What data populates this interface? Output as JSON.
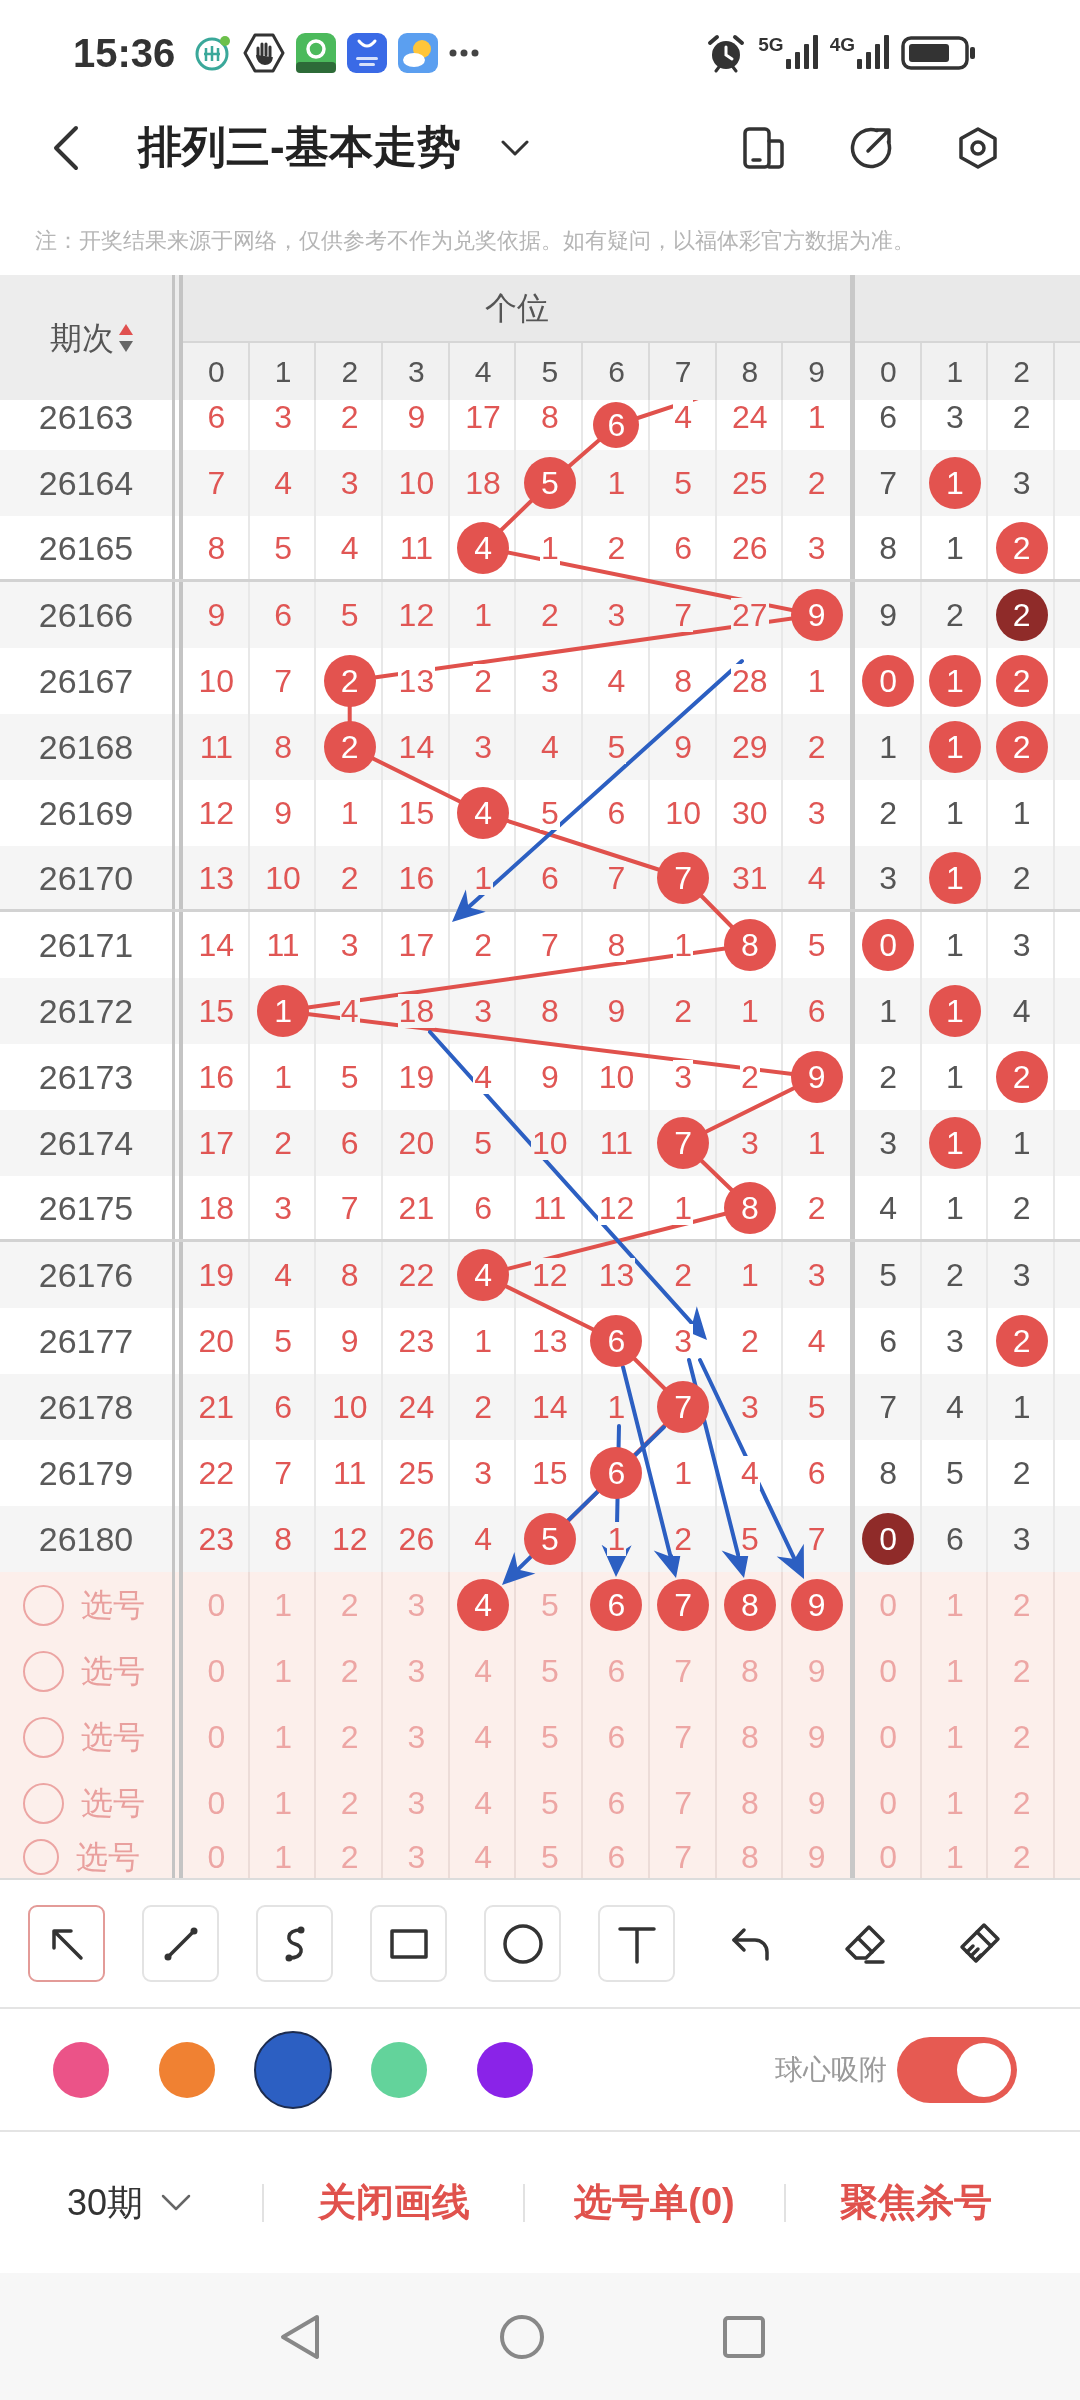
{
  "status_bar": {
    "time": "15:36",
    "networks": [
      "5G",
      "4G"
    ]
  },
  "header": {
    "title": "排列三-基本走势"
  },
  "notice": "注：开奖结果来源于网络，仅供参考不作为兑奖依据。如有疑问，以福体彩官方数据为准。",
  "table": {
    "period_header": "期次",
    "groups": [
      {
        "title": "个位",
        "kind": "accent",
        "columns": [
          "0",
          "1",
          "2",
          "3",
          "4",
          "5",
          "6",
          "7",
          "8",
          "9"
        ]
      },
      {
        "kind": "muted",
        "columns": [
          "0",
          "1",
          "2"
        ]
      }
    ],
    "rows": [
      {
        "period": "26163",
        "cells": [
          [
            {
              "text": "6",
              "kind": "plain"
            },
            {
              "text": "3",
              "kind": "plain"
            },
            {
              "text": "2",
              "kind": "plain"
            },
            {
              "text": "9",
              "kind": "plain"
            },
            {
              "text": "17",
              "kind": "plain"
            },
            {
              "text": "8",
              "kind": "plain"
            },
            {
              "text": "6",
              "kind": "ball"
            },
            {
              "text": "4",
              "kind": "plain"
            },
            {
              "text": "24",
              "kind": "plain"
            },
            {
              "text": "1",
              "kind": "plain"
            }
          ],
          [
            {
              "text": "6",
              "kind": "plain"
            },
            {
              "text": "3",
              "kind": "plain"
            },
            {
              "text": "2",
              "kind": "plain"
            }
          ]
        ]
      },
      {
        "period": "26164",
        "cells": [
          [
            {
              "text": "7",
              "kind": "plain"
            },
            {
              "text": "4",
              "kind": "plain"
            },
            {
              "text": "3",
              "kind": "plain"
            },
            {
              "text": "10",
              "kind": "plain"
            },
            {
              "text": "18",
              "kind": "plain"
            },
            {
              "text": "5",
              "kind": "ball"
            },
            {
              "text": "1",
              "kind": "plain"
            },
            {
              "text": "5",
              "kind": "plain"
            },
            {
              "text": "25",
              "kind": "plain"
            },
            {
              "text": "2",
              "kind": "plain"
            }
          ],
          [
            {
              "text": "7",
              "kind": "plain"
            },
            {
              "text": "1",
              "kind": "ball"
            },
            {
              "text": "3",
              "kind": "plain"
            }
          ]
        ]
      },
      {
        "period": "26165",
        "cells": [
          [
            {
              "text": "8",
              "kind": "plain"
            },
            {
              "text": "5",
              "kind": "plain"
            },
            {
              "text": "4",
              "kind": "plain"
            },
            {
              "text": "11",
              "kind": "plain"
            },
            {
              "text": "4",
              "kind": "ball"
            },
            {
              "text": "1",
              "kind": "plain"
            },
            {
              "text": "2",
              "kind": "plain"
            },
            {
              "text": "6",
              "kind": "plain"
            },
            {
              "text": "26",
              "kind": "plain"
            },
            {
              "text": "3",
              "kind": "plain"
            }
          ],
          [
            {
              "text": "8",
              "kind": "plain"
            },
            {
              "text": "1",
              "kind": "plain"
            },
            {
              "text": "2",
              "kind": "ball"
            }
          ]
        ]
      },
      {
        "period": "26166",
        "cells": [
          [
            {
              "text": "9",
              "kind": "plain"
            },
            {
              "text": "6",
              "kind": "plain"
            },
            {
              "text": "5",
              "kind": "plain"
            },
            {
              "text": "12",
              "kind": "plain"
            },
            {
              "text": "1",
              "kind": "plain"
            },
            {
              "text": "2",
              "kind": "plain"
            },
            {
              "text": "3",
              "kind": "plain"
            },
            {
              "text": "7",
              "kind": "plain"
            },
            {
              "text": "27",
              "kind": "plain"
            },
            {
              "text": "9",
              "kind": "ball"
            }
          ],
          [
            {
              "text": "9",
              "kind": "plain"
            },
            {
              "text": "2",
              "kind": "plain"
            },
            {
              "text": "2",
              "kind": "darkball"
            }
          ]
        ]
      },
      {
        "period": "26167",
        "cells": [
          [
            {
              "text": "10",
              "kind": "plain"
            },
            {
              "text": "7",
              "kind": "plain"
            },
            {
              "text": "2",
              "kind": "ball"
            },
            {
              "text": "13",
              "kind": "plain"
            },
            {
              "text": "2",
              "kind": "plain"
            },
            {
              "text": "3",
              "kind": "plain"
            },
            {
              "text": "4",
              "kind": "plain"
            },
            {
              "text": "8",
              "kind": "plain"
            },
            {
              "text": "28",
              "kind": "plain"
            },
            {
              "text": "1",
              "kind": "plain"
            }
          ],
          [
            {
              "text": "0",
              "kind": "ball"
            },
            {
              "text": "1",
              "kind": "ball"
            },
            {
              "text": "2",
              "kind": "ball"
            }
          ]
        ]
      },
      {
        "period": "26168",
        "cells": [
          [
            {
              "text": "11",
              "kind": "plain"
            },
            {
              "text": "8",
              "kind": "plain"
            },
            {
              "text": "2",
              "kind": "ball"
            },
            {
              "text": "14",
              "kind": "plain"
            },
            {
              "text": "3",
              "kind": "plain"
            },
            {
              "text": "4",
              "kind": "plain"
            },
            {
              "text": "5",
              "kind": "plain"
            },
            {
              "text": "9",
              "kind": "plain"
            },
            {
              "text": "29",
              "kind": "plain"
            },
            {
              "text": "2",
              "kind": "plain"
            }
          ],
          [
            {
              "text": "1",
              "kind": "plain"
            },
            {
              "text": "1",
              "kind": "ball"
            },
            {
              "text": "2",
              "kind": "ball"
            }
          ]
        ]
      },
      {
        "period": "26169",
        "cells": [
          [
            {
              "text": "12",
              "kind": "plain"
            },
            {
              "text": "9",
              "kind": "plain"
            },
            {
              "text": "1",
              "kind": "plain"
            },
            {
              "text": "15",
              "kind": "plain"
            },
            {
              "text": "4",
              "kind": "ball"
            },
            {
              "text": "5",
              "kind": "plain"
            },
            {
              "text": "6",
              "kind": "plain"
            },
            {
              "text": "10",
              "kind": "plain"
            },
            {
              "text": "30",
              "kind": "plain"
            },
            {
              "text": "3",
              "kind": "plain"
            }
          ],
          [
            {
              "text": "2",
              "kind": "plain"
            },
            {
              "text": "1",
              "kind": "plain"
            },
            {
              "text": "1",
              "kind": "plain"
            }
          ]
        ]
      },
      {
        "period": "26170",
        "cells": [
          [
            {
              "text": "13",
              "kind": "plain"
            },
            {
              "text": "10",
              "kind": "plain"
            },
            {
              "text": "2",
              "kind": "plain"
            },
            {
              "text": "16",
              "kind": "plain"
            },
            {
              "text": "1",
              "kind": "plain"
            },
            {
              "text": "6",
              "kind": "plain"
            },
            {
              "text": "7",
              "kind": "plain"
            },
            {
              "text": "7",
              "kind": "ball"
            },
            {
              "text": "31",
              "kind": "plain"
            },
            {
              "text": "4",
              "kind": "plain"
            }
          ],
          [
            {
              "text": "3",
              "kind": "plain"
            },
            {
              "text": "1",
              "kind": "ball"
            },
            {
              "text": "2",
              "kind": "plain"
            }
          ]
        ]
      },
      {
        "period": "26171",
        "cells": [
          [
            {
              "text": "14",
              "kind": "plain"
            },
            {
              "text": "11",
              "kind": "plain"
            },
            {
              "text": "3",
              "kind": "plain"
            },
            {
              "text": "17",
              "kind": "plain"
            },
            {
              "text": "2",
              "kind": "plain"
            },
            {
              "text": "7",
              "kind": "plain"
            },
            {
              "text": "8",
              "kind": "plain"
            },
            {
              "text": "1",
              "kind": "plain"
            },
            {
              "text": "8",
              "kind": "ball"
            },
            {
              "text": "5",
              "kind": "plain"
            }
          ],
          [
            {
              "text": "0",
              "kind": "ball"
            },
            {
              "text": "1",
              "kind": "plain"
            },
            {
              "text": "3",
              "kind": "plain"
            }
          ]
        ]
      },
      {
        "period": "26172",
        "cells": [
          [
            {
              "text": "15",
              "kind": "plain"
            },
            {
              "text": "1",
              "kind": "ball"
            },
            {
              "text": "4",
              "kind": "plain"
            },
            {
              "text": "18",
              "kind": "plain"
            },
            {
              "text": "3",
              "kind": "plain"
            },
            {
              "text": "8",
              "kind": "plain"
            },
            {
              "text": "9",
              "kind": "plain"
            },
            {
              "text": "2",
              "kind": "plain"
            },
            {
              "text": "1",
              "kind": "plain"
            },
            {
              "text": "6",
              "kind": "plain"
            }
          ],
          [
            {
              "text": "1",
              "kind": "plain"
            },
            {
              "text": "1",
              "kind": "ball"
            },
            {
              "text": "4",
              "kind": "plain"
            }
          ]
        ]
      },
      {
        "period": "26173",
        "cells": [
          [
            {
              "text": "16",
              "kind": "plain"
            },
            {
              "text": "1",
              "kind": "plain"
            },
            {
              "text": "5",
              "kind": "plain"
            },
            {
              "text": "19",
              "kind": "plain"
            },
            {
              "text": "4",
              "kind": "plain"
            },
            {
              "text": "9",
              "kind": "plain"
            },
            {
              "text": "10",
              "kind": "plain"
            },
            {
              "text": "3",
              "kind": "plain"
            },
            {
              "text": "2",
              "kind": "plain"
            },
            {
              "text": "9",
              "kind": "ball"
            }
          ],
          [
            {
              "text": "2",
              "kind": "plain"
            },
            {
              "text": "1",
              "kind": "plain"
            },
            {
              "text": "2",
              "kind": "ball"
            }
          ]
        ]
      },
      {
        "period": "26174",
        "cells": [
          [
            {
              "text": "17",
              "kind": "plain"
            },
            {
              "text": "2",
              "kind": "plain"
            },
            {
              "text": "6",
              "kind": "plain"
            },
            {
              "text": "20",
              "kind": "plain"
            },
            {
              "text": "5",
              "kind": "plain"
            },
            {
              "text": "10",
              "kind": "plain"
            },
            {
              "text": "11",
              "kind": "plain"
            },
            {
              "text": "7",
              "kind": "ball"
            },
            {
              "text": "3",
              "kind": "plain"
            },
            {
              "text": "1",
              "kind": "plain"
            }
          ],
          [
            {
              "text": "3",
              "kind": "plain"
            },
            {
              "text": "1",
              "kind": "ball"
            },
            {
              "text": "1",
              "kind": "plain"
            }
          ]
        ]
      },
      {
        "period": "26175",
        "cells": [
          [
            {
              "text": "18",
              "kind": "plain"
            },
            {
              "text": "3",
              "kind": "plain"
            },
            {
              "text": "7",
              "kind": "plain"
            },
            {
              "text": "21",
              "kind": "plain"
            },
            {
              "text": "6",
              "kind": "plain"
            },
            {
              "text": "11",
              "kind": "plain"
            },
            {
              "text": "12",
              "kind": "plain"
            },
            {
              "text": "1",
              "kind": "plain"
            },
            {
              "text": "8",
              "kind": "ball"
            },
            {
              "text": "2",
              "kind": "plain"
            }
          ],
          [
            {
              "text": "4",
              "kind": "plain"
            },
            {
              "text": "1",
              "kind": "plain"
            },
            {
              "text": "2",
              "kind": "plain"
            }
          ]
        ]
      },
      {
        "period": "26176",
        "cells": [
          [
            {
              "text": "19",
              "kind": "plain"
            },
            {
              "text": "4",
              "kind": "plain"
            },
            {
              "text": "8",
              "kind": "plain"
            },
            {
              "text": "22",
              "kind": "plain"
            },
            {
              "text": "4",
              "kind": "ball"
            },
            {
              "text": "12",
              "kind": "plain"
            },
            {
              "text": "13",
              "kind": "plain"
            },
            {
              "text": "2",
              "kind": "plain"
            },
            {
              "text": "1",
              "kind": "plain"
            },
            {
              "text": "3",
              "kind": "plain"
            }
          ],
          [
            {
              "text": "5",
              "kind": "plain"
            },
            {
              "text": "2",
              "kind": "plain"
            },
            {
              "text": "3",
              "kind": "plain"
            }
          ]
        ]
      },
      {
        "period": "26177",
        "cells": [
          [
            {
              "text": "20",
              "kind": "plain"
            },
            {
              "text": "5",
              "kind": "plain"
            },
            {
              "text": "9",
              "kind": "plain"
            },
            {
              "text": "23",
              "kind": "plain"
            },
            {
              "text": "1",
              "kind": "plain"
            },
            {
              "text": "13",
              "kind": "plain"
            },
            {
              "text": "6",
              "kind": "ball"
            },
            {
              "text": "3",
              "kind": "plain"
            },
            {
              "text": "2",
              "kind": "plain"
            },
            {
              "text": "4",
              "kind": "plain"
            }
          ],
          [
            {
              "text": "6",
              "kind": "plain"
            },
            {
              "text": "3",
              "kind": "plain"
            },
            {
              "text": "2",
              "kind": "ball"
            }
          ]
        ]
      },
      {
        "period": "26178",
        "cells": [
          [
            {
              "text": "21",
              "kind": "plain"
            },
            {
              "text": "6",
              "kind": "plain"
            },
            {
              "text": "10",
              "kind": "plain"
            },
            {
              "text": "24",
              "kind": "plain"
            },
            {
              "text": "2",
              "kind": "plain"
            },
            {
              "text": "14",
              "kind": "plain"
            },
            {
              "text": "1",
              "kind": "plain"
            },
            {
              "text": "7",
              "kind": "ball"
            },
            {
              "text": "3",
              "kind": "plain"
            },
            {
              "text": "5",
              "kind": "plain"
            }
          ],
          [
            {
              "text": "7",
              "kind": "plain"
            },
            {
              "text": "4",
              "kind": "plain"
            },
            {
              "text": "1",
              "kind": "plain"
            }
          ]
        ]
      },
      {
        "period": "26179",
        "cells": [
          [
            {
              "text": "22",
              "kind": "plain"
            },
            {
              "text": "7",
              "kind": "plain"
            },
            {
              "text": "11",
              "kind": "plain"
            },
            {
              "text": "25",
              "kind": "plain"
            },
            {
              "text": "3",
              "kind": "plain"
            },
            {
              "text": "15",
              "kind": "plain"
            },
            {
              "text": "6",
              "kind": "ball"
            },
            {
              "text": "1",
              "kind": "plain"
            },
            {
              "text": "4",
              "kind": "plain"
            },
            {
              "text": "6",
              "kind": "plain"
            }
          ],
          [
            {
              "text": "8",
              "kind": "plain"
            },
            {
              "text": "5",
              "kind": "plain"
            },
            {
              "text": "2",
              "kind": "plain"
            }
          ]
        ]
      },
      {
        "period": "26180",
        "cells": [
          [
            {
              "text": "23",
              "kind": "plain"
            },
            {
              "text": "8",
              "kind": "plain"
            },
            {
              "text": "12",
              "kind": "plain"
            },
            {
              "text": "26",
              "kind": "plain"
            },
            {
              "text": "4",
              "kind": "plain"
            },
            {
              "text": "5",
              "kind": "ball"
            },
            {
              "text": "1",
              "kind": "plain"
            },
            {
              "text": "2",
              "kind": "plain"
            },
            {
              "text": "5",
              "kind": "plain"
            },
            {
              "text": "7",
              "kind": "plain"
            }
          ],
          [
            {
              "text": "0",
              "kind": "darkball"
            },
            {
              "text": "6",
              "kind": "plain"
            },
            {
              "text": "3",
              "kind": "plain"
            }
          ]
        ]
      }
    ],
    "pick_rows": [
      {
        "label": "选号",
        "checked": false,
        "cells": [
          [
            {
              "text": "0",
              "selected": false
            },
            {
              "text": "1",
              "selected": false
            },
            {
              "text": "2",
              "selected": false
            },
            {
              "text": "3",
              "selected": false
            },
            {
              "text": "4",
              "selected": true
            },
            {
              "text": "5",
              "selected": false
            },
            {
              "text": "6",
              "selected": true
            },
            {
              "text": "7",
              "selected": true
            },
            {
              "text": "8",
              "selected": true
            },
            {
              "text": "9",
              "selected": true
            }
          ],
          [
            {
              "text": "0",
              "selected": false
            },
            {
              "text": "1",
              "selected": false
            },
            {
              "text": "2",
              "selected": false
            }
          ]
        ]
      },
      {
        "label": "选号",
        "checked": false,
        "cells": [
          [
            {
              "text": "0",
              "selected": false
            },
            {
              "text": "1",
              "selected": false
            },
            {
              "text": "2",
              "selected": false
            },
            {
              "text": "3",
              "selected": false
            },
            {
              "text": "4",
              "selected": false
            },
            {
              "text": "5",
              "selected": false
            },
            {
              "text": "6",
              "selected": false
            },
            {
              "text": "7",
              "selected": false
            },
            {
              "text": "8",
              "selected": false
            },
            {
              "text": "9",
              "selected": false
            }
          ],
          [
            {
              "text": "0",
              "selected": false
            },
            {
              "text": "1",
              "selected": false
            },
            {
              "text": "2",
              "selected": false
            }
          ]
        ]
      },
      {
        "label": "选号",
        "checked": false,
        "cells": [
          [
            {
              "text": "0",
              "selected": false
            },
            {
              "text": "1",
              "selected": false
            },
            {
              "text": "2",
              "selected": false
            },
            {
              "text": "3",
              "selected": false
            },
            {
              "text": "4",
              "selected": false
            },
            {
              "text": "5",
              "selected": false
            },
            {
              "text": "6",
              "selected": false
            },
            {
              "text": "7",
              "selected": false
            },
            {
              "text": "8",
              "selected": false
            },
            {
              "text": "9",
              "selected": false
            }
          ],
          [
            {
              "text": "0",
              "selected": false
            },
            {
              "text": "1",
              "selected": false
            },
            {
              "text": "2",
              "selected": false
            }
          ]
        ]
      },
      {
        "label": "选号",
        "checked": false,
        "cells": [
          [
            {
              "text": "0",
              "selected": false
            },
            {
              "text": "1",
              "selected": false
            },
            {
              "text": "2",
              "selected": false
            },
            {
              "text": "3",
              "selected": false
            },
            {
              "text": "4",
              "selected": false
            },
            {
              "text": "5",
              "selected": false
            },
            {
              "text": "6",
              "selected": false
            },
            {
              "text": "7",
              "selected": false
            },
            {
              "text": "8",
              "selected": false
            },
            {
              "text": "9",
              "selected": false
            }
          ],
          [
            {
              "text": "0",
              "selected": false
            },
            {
              "text": "1",
              "selected": false
            },
            {
              "text": "2",
              "selected": false
            }
          ]
        ]
      },
      {
        "label": "选号",
        "checked": false,
        "cells": [
          [
            {
              "text": "0",
              "selected": false
            },
            {
              "text": "1",
              "selected": false
            },
            {
              "text": "2",
              "selected": false
            },
            {
              "text": "3",
              "selected": false
            },
            {
              "text": "4",
              "selected": false
            },
            {
              "text": "5",
              "selected": false
            },
            {
              "text": "6",
              "selected": false
            },
            {
              "text": "7",
              "selected": false
            },
            {
              "text": "8",
              "selected": false
            },
            {
              "text": "9",
              "selected": false
            }
          ],
          [
            {
              "text": "0",
              "selected": false
            },
            {
              "text": "1",
              "selected": false
            },
            {
              "text": "2",
              "selected": false
            }
          ]
        ]
      }
    ]
  },
  "drawing_toolbar": {
    "tools": [
      {
        "selected": true
      },
      {
        "selected": false
      },
      {
        "selected": false
      },
      {
        "selected": false
      },
      {
        "selected": false
      },
      {
        "selected": false
      }
    ]
  },
  "palette": {
    "swatches": [
      {
        "color": "#eb5388",
        "selected": false
      },
      {
        "color": "#f08132",
        "selected": false
      },
      {
        "color": "#2c5fc2",
        "selected": true
      },
      {
        "color": "#63d39b",
        "selected": false
      },
      {
        "color": "#8a23e8",
        "selected": false
      }
    ],
    "snap_toggle": {
      "label": "球心吸附",
      "on": true
    }
  },
  "footer": {
    "period_range": "30期",
    "actions": [
      "关闭画线",
      "选号单(0)",
      "聚焦杀号"
    ]
  }
}
